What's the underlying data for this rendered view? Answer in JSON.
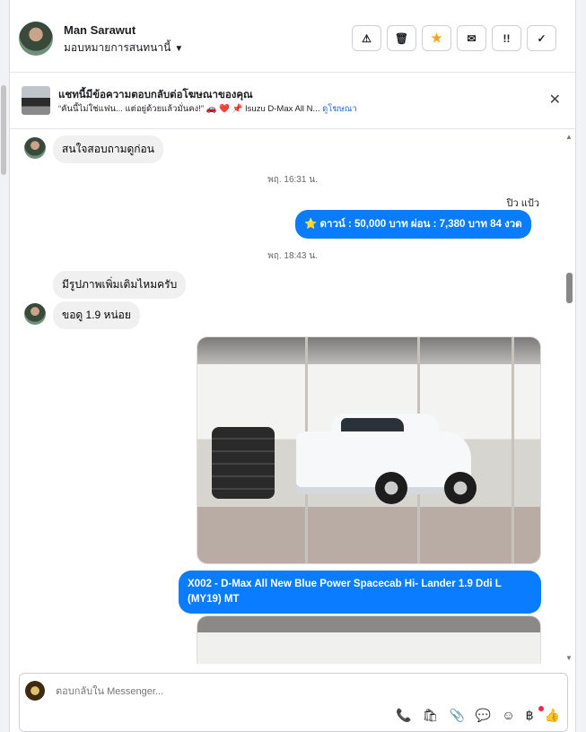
{
  "header": {
    "contact_name": "Man Sarawut",
    "assign_label": "มอบหมายการสนทนานี้",
    "caret": "▼",
    "buttons": [
      {
        "name": "report-spam-button",
        "glyph": "⚠"
      },
      {
        "name": "delete-button",
        "glyph": "🗑"
      },
      {
        "name": "star-button",
        "glyph": "★"
      },
      {
        "name": "mark-unread-button",
        "glyph": "✉"
      },
      {
        "name": "follow-up-button",
        "glyph": "!!"
      },
      {
        "name": "mark-done-button",
        "glyph": "✓"
      }
    ]
  },
  "ad_banner": {
    "title": "แชทนี้มีข้อความตอบกลับต่อโฆษณาของคุณ",
    "subtitle": "“คันนี้ไม่ใช่แฟน... แต่อยู่ด้วยแล้วมั่นคง!” 🚗 ❤️ 📌 Isuzu D-Max All N...",
    "link": "ดูโฆษณา",
    "close": "✕"
  },
  "messages": {
    "m1": "สนใจสอบถามดูก่อน",
    "ts1": "พฤ. 16:31 น.",
    "sender_out": "ปิว แป้ว",
    "m2": "⭐ ดาวน์ : 50,000 บาท ผ่อน : 7,380 บาท 84 งวด",
    "ts2": "พฤ. 18:43 น.",
    "m3": "มีรูปภาพเพิ่มเติมไหมครับ",
    "m4": "ขอดู 1.9 หน่อย",
    "m5": "X002 - D-Max All New Blue Power Spacecab Hi- Lander 1.9 Ddi L (MY19) MT"
  },
  "composer": {
    "placeholder": "ตอบกลับใน Messenger...",
    "tools": [
      "📞",
      "🛍",
      "📎",
      "💬",
      "☺",
      "฿",
      "👍"
    ]
  },
  "scroll": {
    "up": "▲",
    "down": "▼"
  }
}
